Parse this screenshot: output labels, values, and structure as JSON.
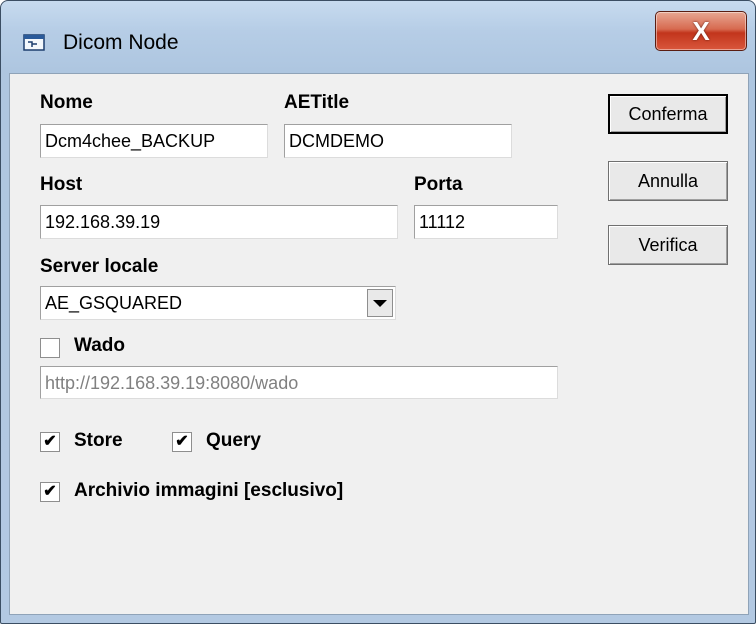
{
  "window": {
    "title": "Dicom Node",
    "close_glyph": "X",
    "icon": "dicom-node-icon"
  },
  "fields": {
    "nome": {
      "label": "Nome",
      "value": "Dcm4chee_BACKUP"
    },
    "aetitle": {
      "label": "AETitle",
      "value": "DCMDEMO"
    },
    "host": {
      "label": "Host",
      "value": "192.168.39.19"
    },
    "porta": {
      "label": "Porta",
      "value": "11112"
    },
    "server_locale": {
      "label": "Server locale",
      "value": "AE_GSQUARED"
    },
    "wado": {
      "label": "Wado",
      "checked": false,
      "url": "http://192.168.39.19:8080/wado"
    }
  },
  "options": {
    "store": {
      "label": "Store",
      "checked": true,
      "mark": "✔"
    },
    "query": {
      "label": "Query",
      "checked": true,
      "mark": "✔"
    },
    "archivio": {
      "label": "Archivio immagini [esclusivo]",
      "checked": true,
      "mark": "✔"
    }
  },
  "buttons": {
    "conferma": "Conferma",
    "annulla": "Annulla",
    "verifica": "Verifica"
  }
}
